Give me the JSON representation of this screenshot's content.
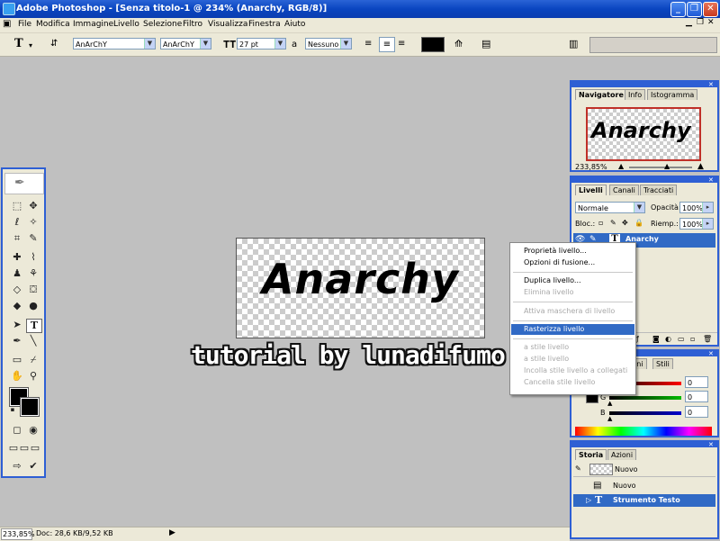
{
  "window": {
    "title": "Adobe Photoshop - [Senza titolo-1 @ 234% (Anarchy, RGB/8)]"
  },
  "menu": [
    "File",
    "Modifica",
    "Immagine",
    "Livello",
    "Selezione",
    "Filtro",
    "Visualizza",
    "Finestra",
    "Aiuto"
  ],
  "options": {
    "tool_glyph": "T",
    "font_family": "AnArChY",
    "font_style": "AnArChY",
    "size": "27 pt",
    "aa_label": "a",
    "antialias": "Nessuno"
  },
  "document": {
    "text": "Anarchy"
  },
  "watermark": "tutorial by lunadifumo",
  "navigator": {
    "tabs": [
      "Navigatore",
      "Info",
      "Istogramma"
    ],
    "thumb_text": "Anarchy",
    "zoom": "233,85%"
  },
  "layers": {
    "tabs": [
      "Livelli",
      "Canali",
      "Tracciati"
    ],
    "blend_mode": "Normale",
    "opacity_label": "Opacità:",
    "opacity": "100%",
    "lock_label": "Bloc.:",
    "fill_label": "Riemp.:",
    "fill": "100%",
    "layer_name": "Anarchy"
  },
  "color": {
    "tabs": [
      "ini",
      "Stili"
    ],
    "rows": [
      {
        "label": "",
        "value": "0"
      },
      {
        "label": "G",
        "value": "0"
      },
      {
        "label": "B",
        "value": "0"
      }
    ]
  },
  "history": {
    "tabs": [
      "Storia",
      "Azioni"
    ],
    "snapshot": "Nuovo",
    "items": [
      "Nuovo",
      "Strumento Testo"
    ]
  },
  "context_menu": [
    {
      "label": "Proprietà livello...",
      "disabled": false
    },
    {
      "label": "Opzioni di fusione...",
      "disabled": false
    },
    {
      "label": "Duplica livello...",
      "disabled": false
    },
    {
      "label": "Elimina livello",
      "disabled": true
    },
    {
      "label": "Attiva maschera di livello",
      "disabled": true
    },
    {
      "label": "Rasterizza livello",
      "highlighted": true
    },
    {
      "label": "a stile livello",
      "disabled": true
    },
    {
      "label": "a stile livello",
      "disabled": true
    },
    {
      "label": "Incolla stile livello a collegati",
      "disabled": true
    },
    {
      "label": "Cancella stile livello",
      "disabled": true
    }
  ],
  "status": {
    "zoom": "233,85%",
    "doc": "Doc: 28,6 KB/9,52 KB"
  },
  "colors": {
    "accent": "#2e5fd4",
    "highlight": "#316ac5",
    "panel": "#ece9d8",
    "workspace": "#c0c0c0"
  }
}
